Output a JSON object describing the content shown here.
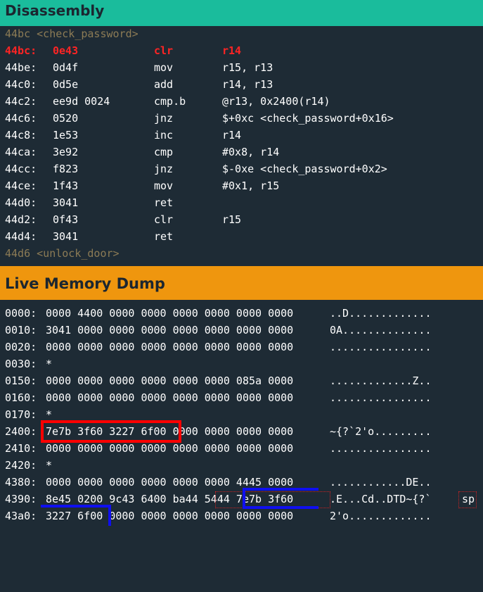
{
  "disassembly": {
    "title": "Disassembly",
    "start_label": "44bc <check_password>",
    "rows": [
      {
        "addr": "44bc:",
        "bytes": "0e43",
        "op": "clr",
        "args": "r14"
      },
      {
        "addr": "44be:",
        "bytes": "0d4f",
        "op": "mov",
        "args": "r15, r13"
      },
      {
        "addr": "44c0:",
        "bytes": "0d5e",
        "op": "add",
        "args": "r14, r13"
      },
      {
        "addr": "44c2:",
        "bytes": "ee9d 0024",
        "op": "cmp.b",
        "args": "@r13, 0x2400(r14)"
      },
      {
        "addr": "44c6:",
        "bytes": "0520",
        "op": "jnz",
        "args": "$+0xc <check_password+0x16>"
      },
      {
        "addr": "44c8:",
        "bytes": "1e53",
        "op": "inc",
        "args": "r14"
      },
      {
        "addr": "44ca:",
        "bytes": "3e92",
        "op": "cmp",
        "args": "#0x8, r14"
      },
      {
        "addr": "44cc:",
        "bytes": "f823",
        "op": "jnz",
        "args": "$-0xe <check_password+0x2>"
      },
      {
        "addr": "44ce:",
        "bytes": "1f43",
        "op": "mov",
        "args": "#0x1, r15"
      },
      {
        "addr": "44d0:",
        "bytes": "3041",
        "op": "ret",
        "args": ""
      },
      {
        "addr": "44d2:",
        "bytes": "0f43",
        "op": "clr",
        "args": "r15"
      },
      {
        "addr": "44d4:",
        "bytes": "3041",
        "op": "ret",
        "args": ""
      }
    ],
    "end_label": "44d6 <unlock_door>"
  },
  "memory": {
    "title": "Live Memory Dump",
    "rows": [
      {
        "addr": "0000:",
        "hex": "0000 4400 0000 0000 0000 0000 0000 0000",
        "ascii": "..D............."
      },
      {
        "addr": "0010:",
        "hex": "3041 0000 0000 0000 0000 0000 0000 0000",
        "ascii": "0A.............."
      },
      {
        "addr": "0020:",
        "hex": "0000 0000 0000 0000 0000 0000 0000 0000",
        "ascii": "................"
      },
      {
        "addr": "0030:",
        "hex": "*",
        "ascii": ""
      },
      {
        "addr": "0150:",
        "hex": "0000 0000 0000 0000 0000 0000 085a 0000",
        "ascii": ".............Z.."
      },
      {
        "addr": "0160:",
        "hex": "0000 0000 0000 0000 0000 0000 0000 0000",
        "ascii": "................"
      },
      {
        "addr": "0170:",
        "hex": "*",
        "ascii": ""
      },
      {
        "addr": "2400:",
        "hex": "7e7b 3f60 3227 6f00 0000 0000 0000 0000",
        "ascii": "~{?`2'o........."
      },
      {
        "addr": "2410:",
        "hex": "0000 0000 0000 0000 0000 0000 0000 0000",
        "ascii": "................"
      },
      {
        "addr": "2420:",
        "hex": "*",
        "ascii": ""
      },
      {
        "addr": "4380:",
        "hex": "0000 0000 0000 0000 0000 0000 4445 0000",
        "ascii": "............DE.."
      },
      {
        "addr": "4390:",
        "hex": "8e45 0200 9c43 6400 ba44 5444 7e7b 3f60",
        "ascii": ".E...Cd..DTD~{?`"
      },
      {
        "addr": "43a0:",
        "hex": "3227 6f00 0000 0000 0000 0000 0000 0000",
        "ascii": "2'o............."
      }
    ],
    "sp_label": "sp"
  },
  "colors": {
    "disassembly_header": "#1abc9c",
    "memory_header": "#ef960e",
    "background": "#1e2b35",
    "highlight": "#ff2424",
    "label": "#8c7b55",
    "box_red": "#ff0000",
    "box_blue": "#0f0ff0"
  }
}
